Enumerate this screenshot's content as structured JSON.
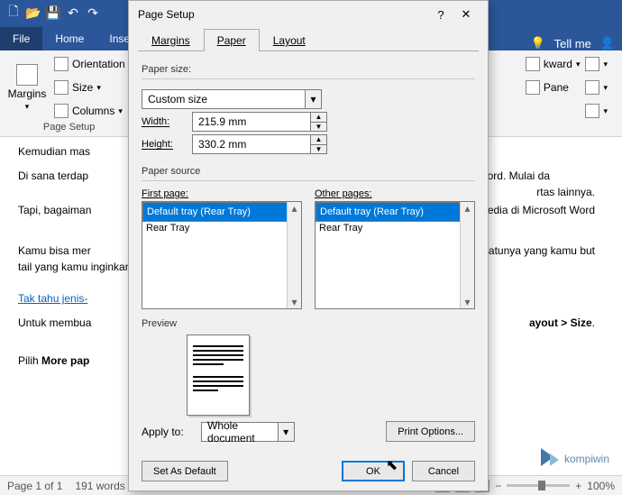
{
  "titlebar": {
    "qat": [
      "🗋",
      "📂",
      "💾",
      "↶",
      "↷"
    ]
  },
  "ribbon_tabs": {
    "file": "File",
    "home": "Home",
    "insert": "Inser",
    "tellme": "Tell me"
  },
  "ribbon": {
    "margins": "Margins",
    "orientation": "Orientation",
    "size": "Size",
    "columns": "Columns",
    "group_label": "Page Setup",
    "right": {
      "kward": "kward",
      "pane": "Pane"
    }
  },
  "document": {
    "p1": "Kemudian mas",
    "p2a": "Di sana terdap",
    "p2b": "rosoft Word. Mulai da",
    "p2c": "rtas lainnya.",
    "p3a": "Tapi, bagaiman",
    "p3b": "tersedia di Microsoft Word",
    "p4a": "Kamu bisa mer",
    "p4b": "u-satunya yang kamu but",
    "p4c": "tail yang kamu inginkan",
    "link": "Tak tahu jenis-",
    "p5a": "Untuk membua",
    "p5b": "ayout > Size",
    "p5c": ".",
    "p6": "Pilih ",
    "p6b": "More pap"
  },
  "statusbar": {
    "page": "Page 1 of 1",
    "words": "191 words",
    "zoom": "100%"
  },
  "dialog": {
    "title": "Page Setup",
    "help": "?",
    "close": "✕",
    "tabs": {
      "margins": "Margins",
      "paper": "Paper",
      "layout": "Layout"
    },
    "paper_size_label": "Paper size:",
    "paper_size_value": "Custom size",
    "width_label": "Width:",
    "width_value": "215.9 mm",
    "height_label": "Height:",
    "height_value": "330.2 mm",
    "paper_source_label": "Paper source",
    "first_page_label": "First page:",
    "other_pages_label": "Other pages:",
    "tray_default": "Default tray (Rear Tray)",
    "tray_rear": "Rear Tray",
    "preview_label": "Preview",
    "apply_to_label": "Apply to:",
    "apply_to_value": "Whole document",
    "print_options": "Print Options...",
    "set_default": "Set As Default",
    "ok": "OK",
    "cancel": "Cancel"
  },
  "watermark": "kompiwin"
}
